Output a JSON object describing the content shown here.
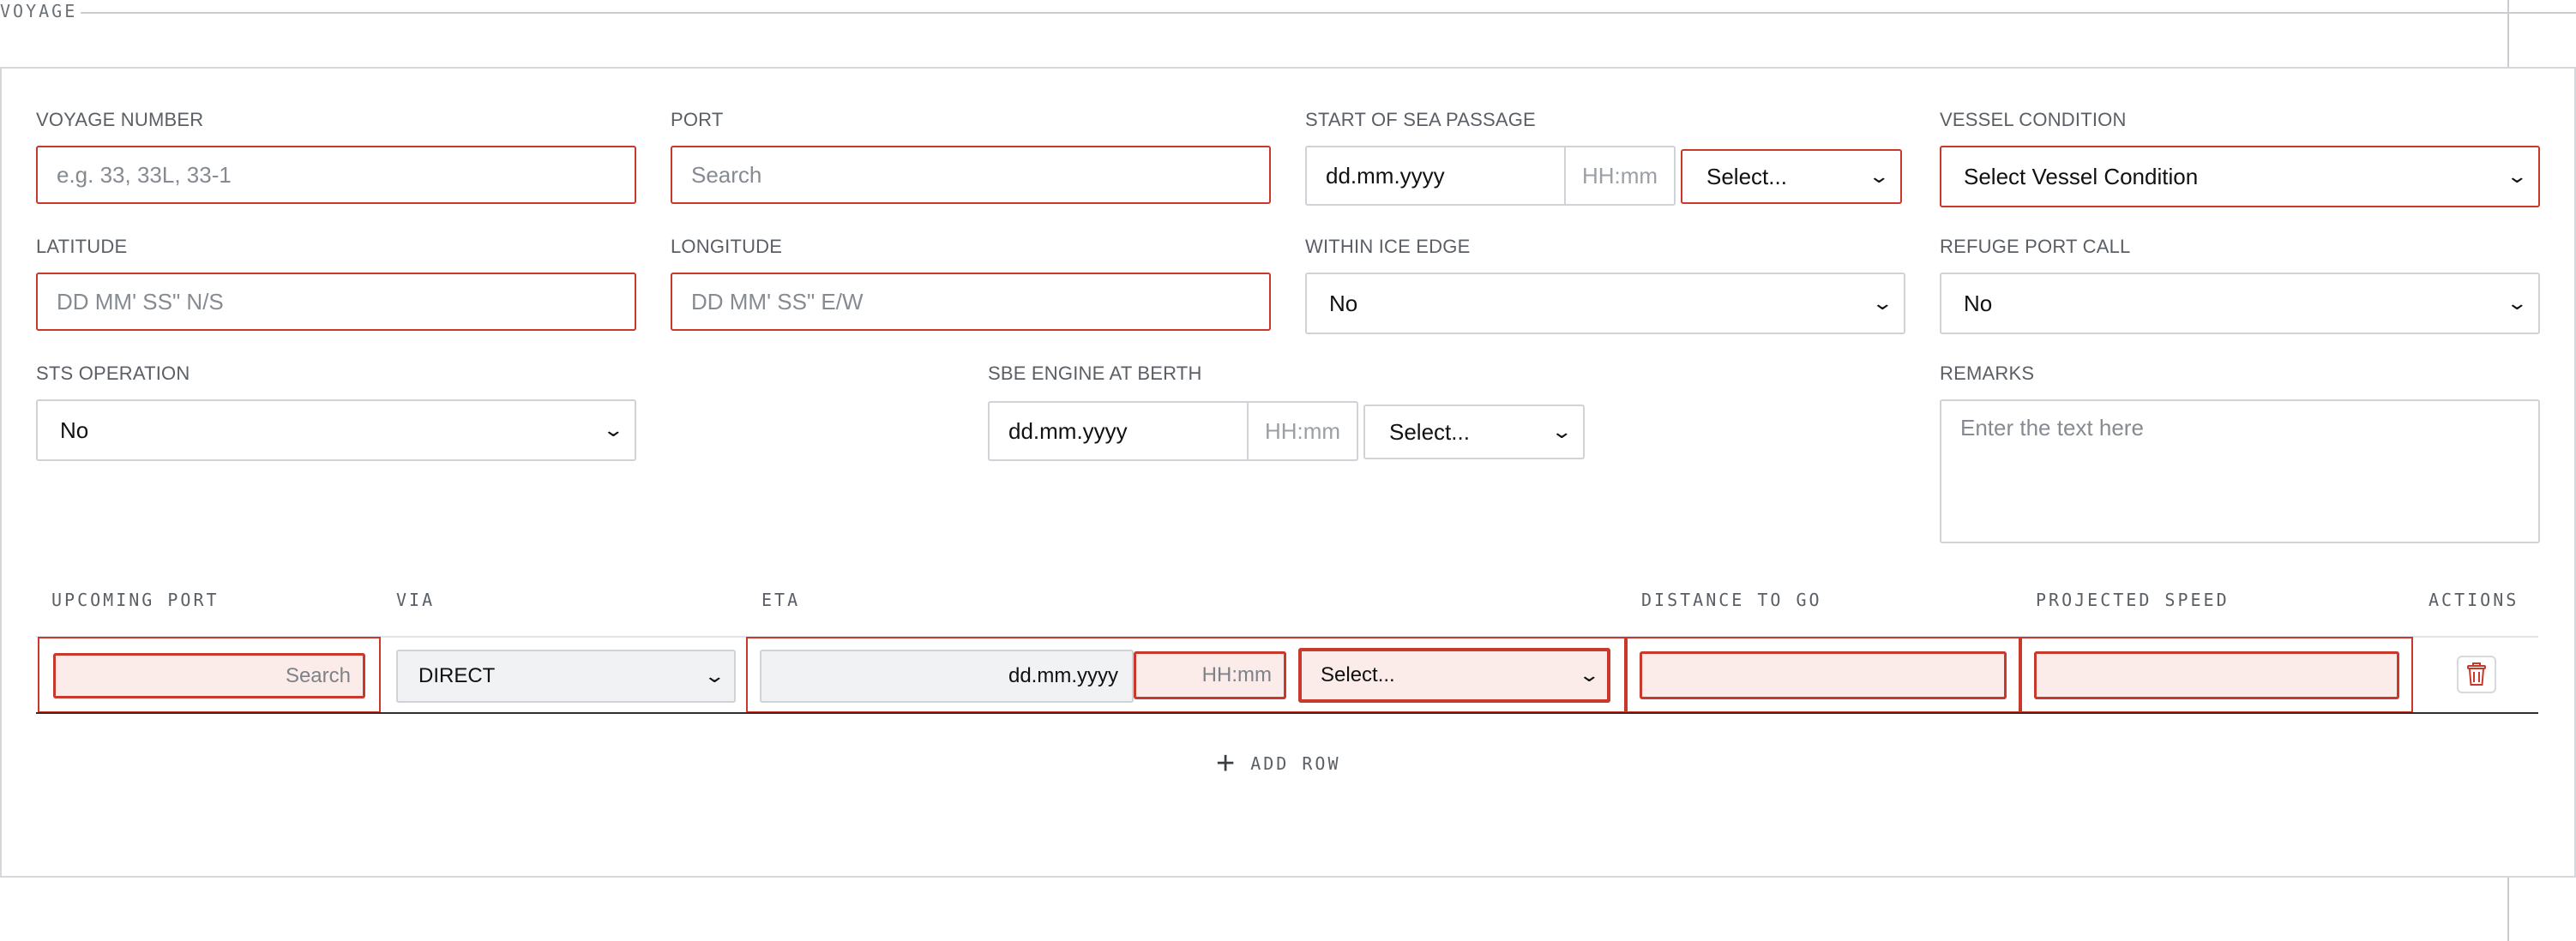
{
  "section": {
    "legend": "VOYAGE"
  },
  "fields": {
    "voyage_number": {
      "label": "VOYAGE NUMBER",
      "placeholder": "e.g. 33, 33L, 33-1"
    },
    "port": {
      "label": "PORT",
      "placeholder": "Search"
    },
    "start_of_sea_passage": {
      "label": "START OF SEA PASSAGE",
      "date_placeholder": "dd.mm.yyyy",
      "time_placeholder": "HH:mm",
      "select_value": "Select..."
    },
    "vessel_condition": {
      "label": "VESSEL CONDITION",
      "value": "Select Vessel Condition"
    },
    "latitude": {
      "label": "LATITUDE",
      "placeholder": "DD MM' SS\" N/S"
    },
    "longitude": {
      "label": "LONGITUDE",
      "placeholder": "DD MM' SS\" E/W"
    },
    "within_ice_edge": {
      "label": "WITHIN ICE EDGE",
      "value": "No"
    },
    "refuge_port_call": {
      "label": "REFUGE PORT CALL",
      "value": "No"
    },
    "sts_operation": {
      "label": "STS OPERATION",
      "value": "No"
    },
    "sbe_engine_at_berth": {
      "label": "SBE ENGINE AT BERTH",
      "date_placeholder": "dd.mm.yyyy",
      "time_placeholder": "HH:mm",
      "select_value": "Select..."
    },
    "remarks": {
      "label": "REMARKS",
      "placeholder": "Enter the text here"
    }
  },
  "table": {
    "headers": [
      "UPCOMING PORT",
      "VIA",
      "ETA",
      "DISTANCE TO GO",
      "PROJECTED SPEED",
      "ACTIONS"
    ],
    "rows": [
      {
        "port_placeholder": "Search",
        "via": "DIRECT",
        "eta_date_placeholder": "dd.mm.yyyy",
        "eta_time_placeholder": "HH:mm",
        "eta_select": "Select...",
        "distance_to_go": "",
        "projected_speed": "",
        "action_icon": "trash-icon"
      }
    ],
    "add_row_label": "ADD ROW"
  },
  "colors": {
    "error_border": "#c8392b",
    "error_fill": "#fbecea",
    "neutral_border": "#cfd3d8"
  }
}
